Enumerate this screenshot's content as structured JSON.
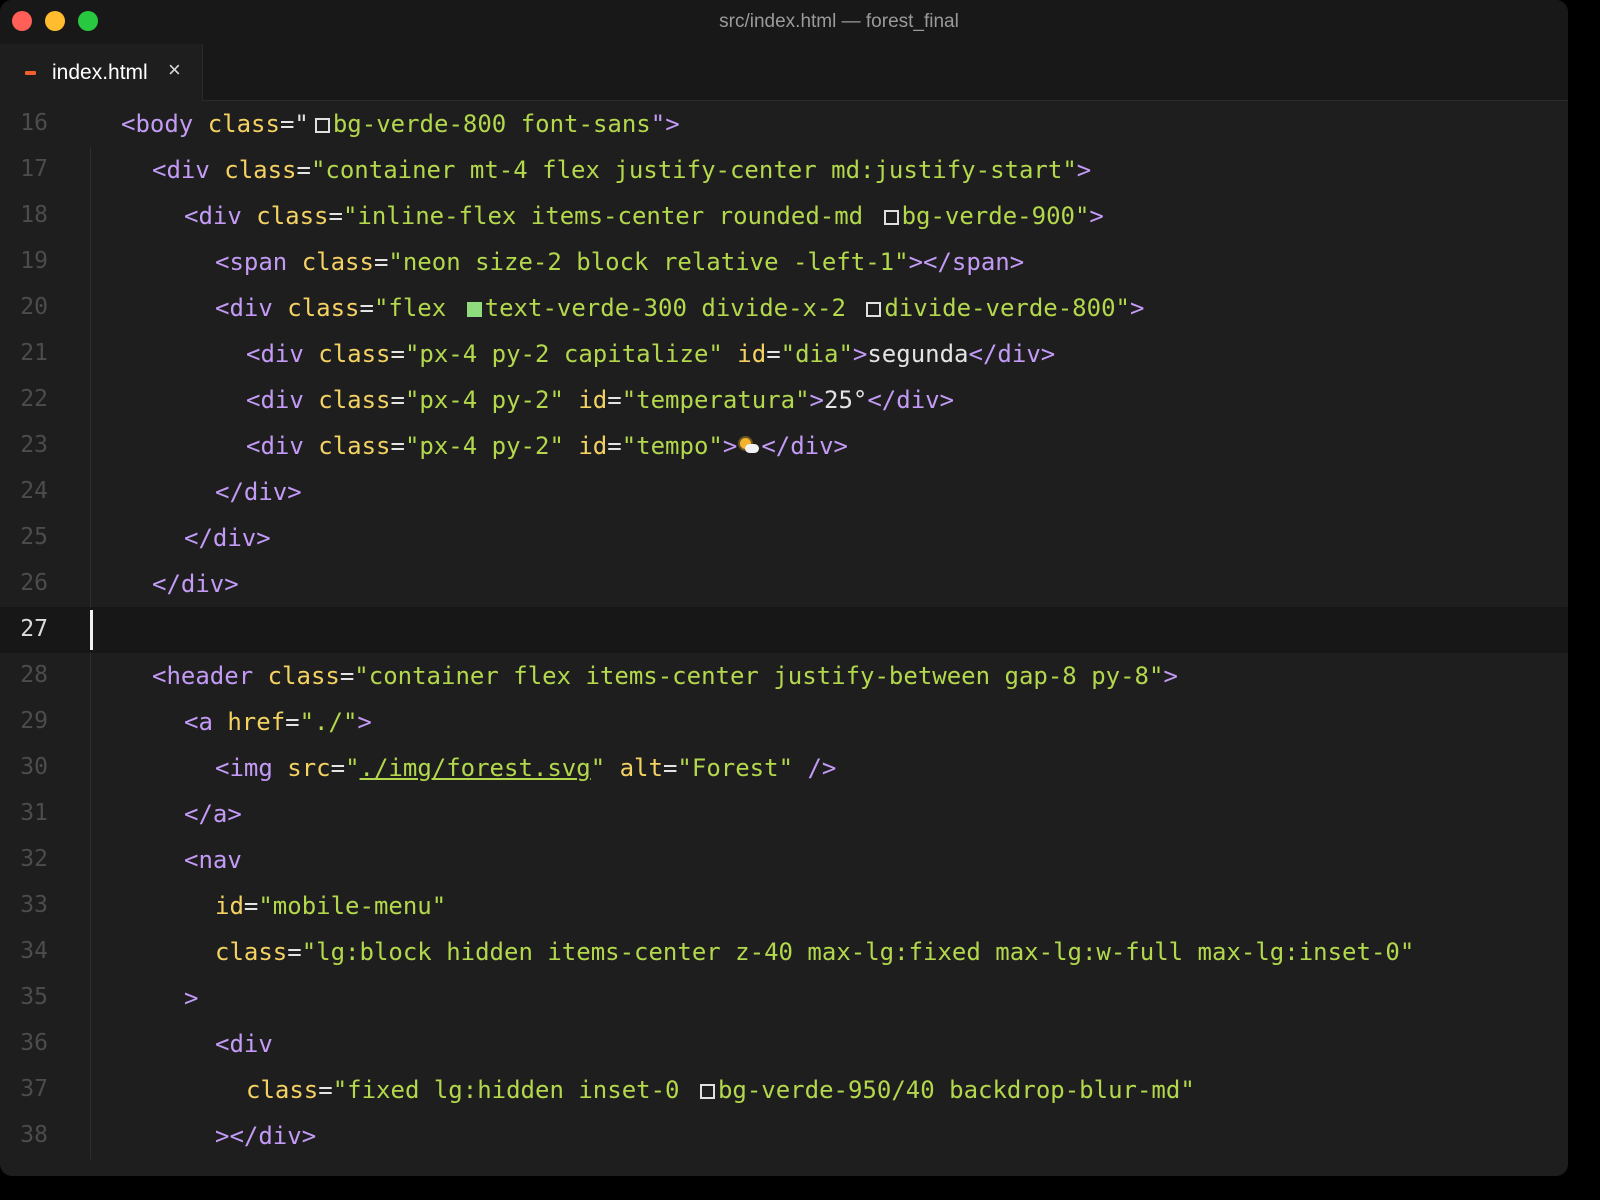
{
  "window": {
    "title": "src/index.html — forest_final"
  },
  "tab": {
    "label": "index.html",
    "close_glyph": "×",
    "icon": "html-file-icon"
  },
  "colors": {
    "tag": "#c39bf6",
    "attr": "#f4d262",
    "string": "#b3d84c",
    "text": "#e4e4e4",
    "line_number": "#4c4c4c",
    "background": "#1e1e1e",
    "swatch_green": "#8fdc7e"
  },
  "editor": {
    "current_line": "27",
    "lines": [
      {
        "n": "16",
        "c1": "<body ",
        "c2": "class",
        "c3": "=\"",
        "c4": "bg-verde-800 font-sans",
        "c5": "\">"
      },
      {
        "n": "17",
        "c1": "<div ",
        "c2": "class",
        "c3": "=",
        "c4": "\"container mt-4 flex justify-center md:justify-start\"",
        "c5": ">"
      },
      {
        "n": "18",
        "c1": "<div ",
        "c2": "class",
        "c3": "=",
        "c4": "\"inline-flex items-center rounded-md ",
        "c5": "bg-verde-900\"",
        "c6": ">"
      },
      {
        "n": "19",
        "c1": "<span ",
        "c2": "class",
        "c3": "=",
        "c4": "\"neon size-2 block relative -left-1\"",
        "c5": "></span>"
      },
      {
        "n": "20",
        "c1": "<div ",
        "c2": "class",
        "c3": "=",
        "c4": "\"flex ",
        "c5": "text-verde-300 divide-x-2 ",
        "c6": "divide-verde-800\"",
        "c7": ">"
      },
      {
        "n": "21",
        "c1": "<div ",
        "c2": "class",
        "c3": "=",
        "c4": "\"px-4 py-2 capitalize\" ",
        "c5": "id",
        "c6": "=",
        "c7": "\"dia\"",
        "c8": ">",
        "c9": "segunda",
        "c10": "</div>"
      },
      {
        "n": "22",
        "c1": "<div ",
        "c2": "class",
        "c3": "=",
        "c4": "\"px-4 py-2\" ",
        "c5": "id",
        "c6": "=",
        "c7": "\"temperatura\"",
        "c8": ">",
        "c9": "25°",
        "c10": "</div>"
      },
      {
        "n": "23",
        "c1": "<div ",
        "c2": "class",
        "c3": "=",
        "c4": "\"px-4 py-2\" ",
        "c5": "id",
        "c6": "=",
        "c7": "\"tempo\"",
        "c8": ">",
        "c9": "</div>"
      },
      {
        "n": "24",
        "c1": "</div>"
      },
      {
        "n": "25",
        "c1": "</div>"
      },
      {
        "n": "26",
        "c1": "</div>"
      },
      {
        "n": "27"
      },
      {
        "n": "28",
        "c1": "<header ",
        "c2": "class",
        "c3": "=",
        "c4": "\"container flex items-center justify-between gap-8 py-8\"",
        "c5": ">"
      },
      {
        "n": "29",
        "c1": "<a ",
        "c2": "href",
        "c3": "=",
        "c4": "\"./\"",
        "c5": ">"
      },
      {
        "n": "30",
        "c1": "<img ",
        "c2": "src",
        "c3": "=",
        "c4": "\"",
        "c5": "./img/forest.svg",
        "c6": "\" ",
        "c7": "alt",
        "c8": "=",
        "c9": "\"Forest\" ",
        "c10": "/>"
      },
      {
        "n": "31",
        "c1": "</a>"
      },
      {
        "n": "32",
        "c1": "<nav"
      },
      {
        "n": "33",
        "c1": "id",
        "c2": "=",
        "c3": "\"mobile-menu\""
      },
      {
        "n": "34",
        "c1": "class",
        "c2": "=",
        "c3": "\"lg:block hidden items-center z-40 max-lg:fixed max-lg:w-full max-lg:inset-0\""
      },
      {
        "n": "35",
        "c1": ">"
      },
      {
        "n": "36",
        "c1": "<div"
      },
      {
        "n": "37",
        "c1": "class",
        "c2": "=",
        "c3": "\"fixed lg:hidden inset-0 ",
        "c4": "bg-verde-950/40 backdrop-blur-md\""
      },
      {
        "n": "38",
        "c1": "></div>"
      }
    ]
  }
}
